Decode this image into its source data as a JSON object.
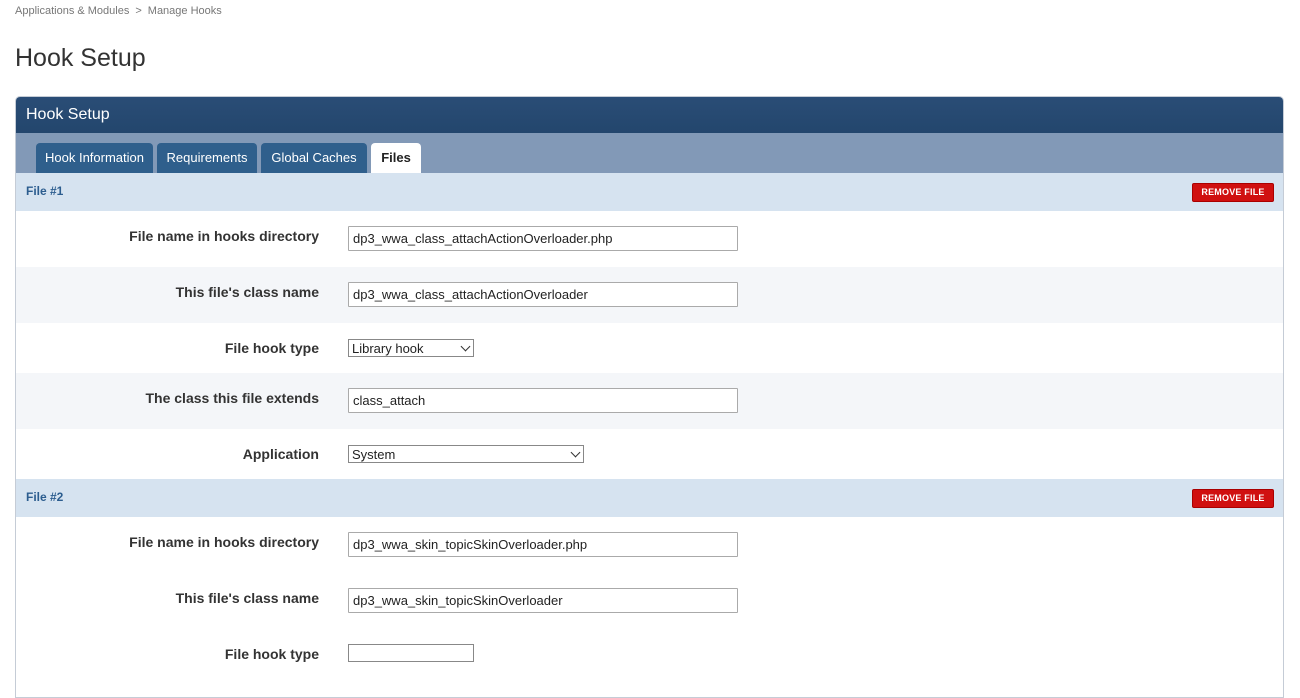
{
  "breadcrumb": {
    "items": [
      "Applications & Modules",
      "Manage Hooks"
    ],
    "separator": ">"
  },
  "page_title": "Hook Setup",
  "panel": {
    "title": "Hook Setup",
    "tabs": [
      {
        "label": "Hook Information",
        "active": false
      },
      {
        "label": "Requirements",
        "active": false
      },
      {
        "label": "Global Caches",
        "active": false
      },
      {
        "label": "Files",
        "active": true
      }
    ]
  },
  "remove_label": "REMOVE FILE",
  "files": [
    {
      "title": "File #1",
      "fields": {
        "filename_label": "File name in hooks directory",
        "filename_value": "dp3_wwa_class_attachActionOverloader.php",
        "classname_label": "This file's class name",
        "classname_value": "dp3_wwa_class_attachActionOverloader",
        "hooktype_label": "File hook type",
        "hooktype_value": "Library hook",
        "extends_label": "The class this file extends",
        "extends_value": "class_attach",
        "application_label": "Application",
        "application_value": "System"
      }
    },
    {
      "title": "File #2",
      "fields": {
        "filename_label": "File name in hooks directory",
        "filename_value": "dp3_wwa_skin_topicSkinOverloader.php",
        "classname_label": "This file's class name",
        "classname_value": "dp3_wwa_skin_topicSkinOverloader",
        "hooktype_label": "File hook type"
      }
    }
  ]
}
